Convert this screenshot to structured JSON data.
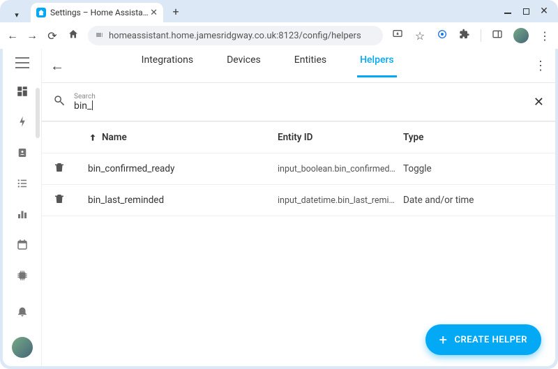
{
  "browser": {
    "tab_title": "Settings – Home Assista…",
    "url": "homeassistant.home.jamesridgway.co.uk:8123/config/helpers"
  },
  "nav": {
    "tabs": [
      "Integrations",
      "Devices",
      "Entities",
      "Helpers"
    ],
    "active_tab_index": 3
  },
  "search": {
    "label": "Search",
    "value": "bin_"
  },
  "table": {
    "columns": [
      "Name",
      "Entity ID",
      "Type"
    ],
    "rows": [
      {
        "icon": "trash",
        "name": "bin_confirmed_ready",
        "entity_id": "input_boolean.bin_confirmed_re…",
        "type": "Toggle"
      },
      {
        "icon": "trash",
        "name": "bin_last_reminded",
        "entity_id": "input_datetime.bin_last_reminded",
        "type": "Date and/or time"
      }
    ]
  },
  "fab": {
    "label": "CREATE HELPER"
  }
}
